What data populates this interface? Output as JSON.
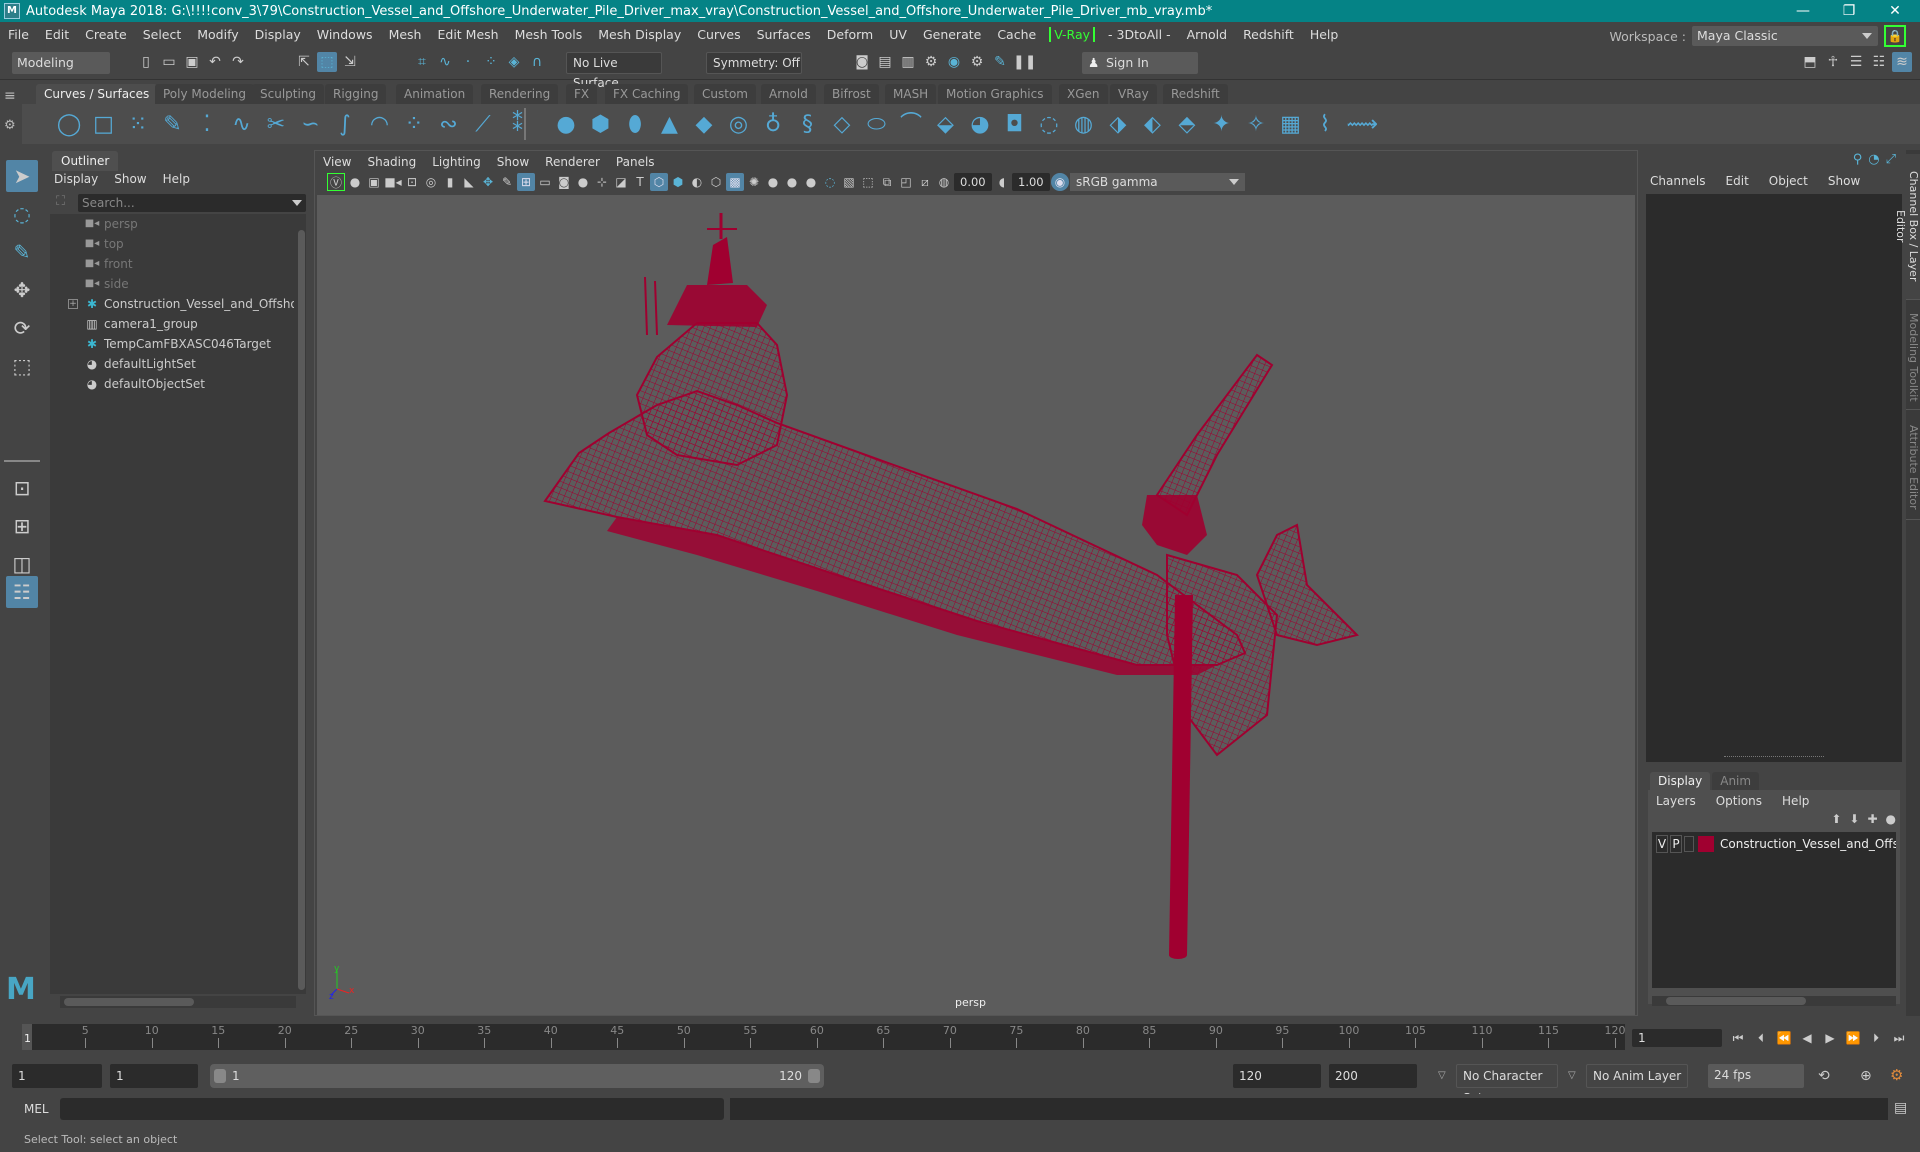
{
  "window": {
    "title": "Autodesk Maya 2018: G:\\!!!!conv_3\\79\\Construction_Vessel_and_Offshore_Underwater_Pile_Driver_max_vray\\Construction_Vessel_and_Offshore_Underwater_Pile_Driver_mb_vray.mb*",
    "logo": "M",
    "minimize": "—",
    "maximize": "❐",
    "close": "✕"
  },
  "menubar": [
    "File",
    "Edit",
    "Create",
    "Select",
    "Modify",
    "Display",
    "Windows",
    "Mesh",
    "Edit Mesh",
    "Mesh Tools",
    "Mesh Display",
    "Curves",
    "Surfaces",
    "Deform",
    "UV",
    "Generate",
    "Cache",
    "V-Ray",
    "- 3DtoAll -",
    "Arnold",
    "Redshift",
    "Help"
  ],
  "workspace": {
    "label": "Workspace :",
    "value": "Maya Classic",
    "lock_icon": "🔒"
  },
  "statusline": {
    "mode": "Modeling",
    "live_surface": "No Live Surface",
    "symmetry": "Symmetry: Off",
    "sign_in": "Sign In"
  },
  "shelf_tabs": [
    "Curves / Surfaces",
    "Poly Modeling",
    "Sculpting",
    "Rigging",
    "Animation",
    "Rendering",
    "FX",
    "FX Caching",
    "Custom",
    "Arnold",
    "Bifrost",
    "MASH",
    "Motion Graphics",
    "XGen",
    "VRay",
    "Redshift"
  ],
  "shelf_active": "Curves / Surfaces",
  "outliner": {
    "title": "Outliner",
    "menu": [
      "Display",
      "Show",
      "Help"
    ],
    "search_placeholder": "Search...",
    "items": [
      {
        "label": "persp",
        "icon": "camera-icon",
        "kind": "cam"
      },
      {
        "label": "top",
        "icon": "camera-icon",
        "kind": "cam"
      },
      {
        "label": "front",
        "icon": "camera-icon",
        "kind": "cam"
      },
      {
        "label": "side",
        "icon": "camera-icon",
        "kind": "cam"
      },
      {
        "label": "Construction_Vessel_and_Offshore_U",
        "icon": "transform-icon",
        "kind": "node",
        "expandable": true
      },
      {
        "label": "camera1_group",
        "icon": "group-icon",
        "kind": "node"
      },
      {
        "label": "TempCamFBXASC046Target",
        "icon": "transform-icon",
        "kind": "node"
      },
      {
        "label": "defaultLightSet",
        "icon": "set-icon",
        "kind": "node"
      },
      {
        "label": "defaultObjectSet",
        "icon": "set-icon",
        "kind": "node"
      }
    ]
  },
  "viewport": {
    "menu": [
      "View",
      "Shading",
      "Lighting",
      "Show",
      "Renderer",
      "Panels"
    ],
    "exposure": "0.00",
    "gamma": "1.00",
    "color_space": "sRGB gamma",
    "camera_label": "persp",
    "axis": {
      "x": "x",
      "y": "y",
      "z": "z"
    },
    "wireframe_color": "#a00030"
  },
  "channel_box": {
    "menu": [
      "Channels",
      "Edit",
      "Object",
      "Show"
    ]
  },
  "layer_editor": {
    "tabs": [
      "Display",
      "Anim"
    ],
    "active_tab": "Display",
    "menu": [
      "Layers",
      "Options",
      "Help"
    ],
    "layers": [
      {
        "v": "V",
        "p": "P",
        "color": "#a00030",
        "name": "Construction_Vessel_and_Offshore_U"
      }
    ]
  },
  "side_tabs": [
    "Channel Box / Layer Editor",
    "Modeling Toolkit",
    "Attribute Editor"
  ],
  "timeslider": {
    "start": 1,
    "end": 120,
    "current_frame": "1",
    "current_frame_field": "1",
    "tick_labels": [
      5,
      10,
      15,
      20,
      25,
      30,
      35,
      40,
      45,
      50,
      55,
      60,
      65,
      70,
      75,
      80,
      85,
      90,
      95,
      100,
      105,
      110,
      115,
      120
    ]
  },
  "range": {
    "start_field": "1",
    "playback_start": "1",
    "range_start": "1",
    "range_end": "120",
    "playback_end": "120",
    "end_field": "200",
    "character_set": "No Character Set",
    "anim_layer": "No Anim Layer",
    "fps": "24 fps"
  },
  "command_line": {
    "label": "MEL"
  },
  "help_line": "Select Tool: select an object"
}
